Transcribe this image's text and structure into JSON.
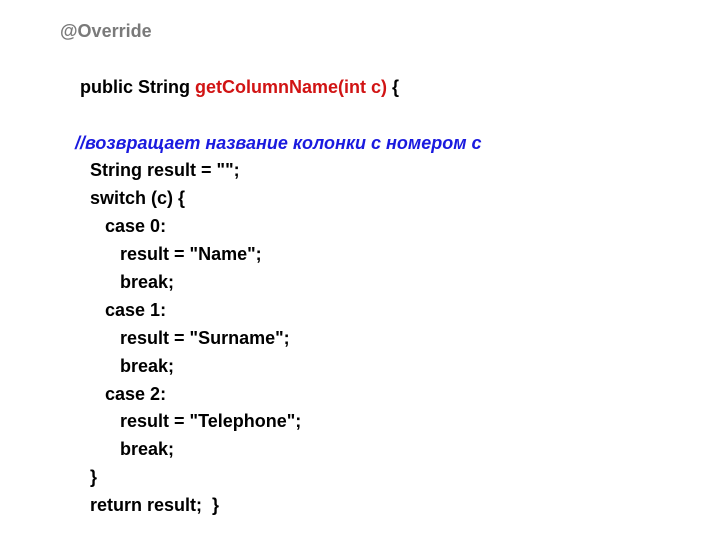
{
  "code": {
    "l1_override": "@Override",
    "l2_pre": "public String ",
    "l2_method": "getColumnName(int c)",
    "l2_post": " {",
    "l3_comment": "   //возвращает название колонки с номером c",
    "l4": "      String result = \"\";",
    "l5": "      switch (c) {",
    "l6": "         case 0:",
    "l7": "            result = \"Name\";",
    "l8": "            break;",
    "l9": "         case 1:",
    "l10": "            result = \"Surname\";",
    "l11": "            break;",
    "l12": "         case 2:",
    "l13": "            result = \"Telephone\";",
    "l14": "            break;",
    "l15": "      }",
    "l16": "      return result;  }"
  }
}
